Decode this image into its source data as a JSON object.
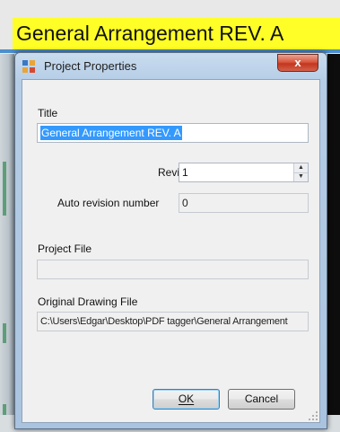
{
  "background": {
    "document_title": "General Arrangement REV. A"
  },
  "dialog": {
    "title": "Project Properties",
    "close_glyph": "x",
    "title_label": "Title",
    "title_value": "General Arrangement REV. A",
    "revision_label": "Revision",
    "revision_value": "1",
    "auto_revision_label": "Auto revision number",
    "auto_revision_value": "0",
    "project_file_label": "Project File",
    "project_file_value": "",
    "original_drawing_label": "Original Drawing File",
    "original_drawing_value": "C:\\Users\\Edgar\\Desktop\\PDF tagger\\General Arrangement",
    "ok_label": "OK",
    "cancel_label": "Cancel"
  },
  "colors": {
    "highlight": "#ffff27",
    "selection": "#3399ff",
    "close_button": "#c3361f"
  },
  "icons": [
    "app-icon",
    "close-icon",
    "spin-up-icon",
    "spin-down-icon",
    "resize-grip-icon"
  ]
}
